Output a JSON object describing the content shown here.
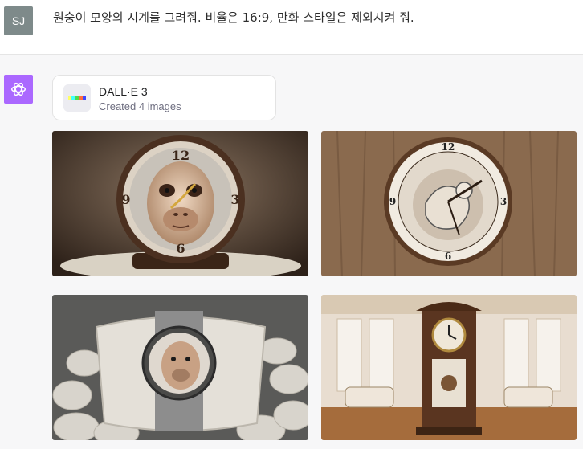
{
  "user": {
    "initials": "SJ",
    "message": "원숭이 모양의 시계를 그려줘. 비율은 16:9, 만화 스타일은 제외시켜 줘."
  },
  "assistant": {
    "avatar_icon": "openai-logo-icon",
    "tool": {
      "name": "DALL·E 3",
      "status": "Created 4 images",
      "icon": "dalle-color-strip-icon",
      "colors": [
        "#ffff66",
        "#42ffff",
        "#51da4c",
        "#ff6e3c",
        "#3c46ff"
      ]
    },
    "images": [
      {
        "name": "generated-image-1"
      },
      {
        "name": "generated-image-2"
      },
      {
        "name": "generated-image-3"
      },
      {
        "name": "generated-image-4"
      }
    ]
  },
  "theme": {
    "user_avatar_bg": "#7e8a8a",
    "assistant_avatar_bg": "#ab68ff",
    "assistant_row_bg": "#f7f7f8"
  }
}
